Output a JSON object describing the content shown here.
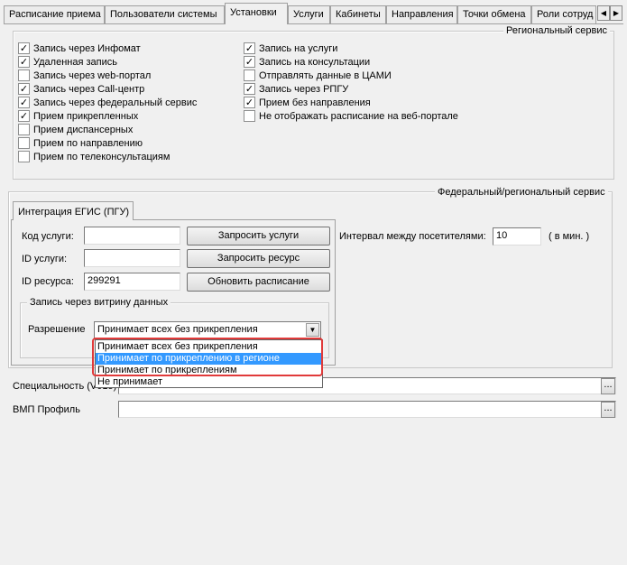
{
  "tabs": [
    {
      "label": "Расписание приема"
    },
    {
      "label": "Пользователи системы"
    },
    {
      "label": "Установки"
    },
    {
      "label": "Услуги"
    },
    {
      "label": "Кабинеты"
    },
    {
      "label": "Направления"
    },
    {
      "label": "Точки обмена"
    },
    {
      "label": "Роли сотруд"
    }
  ],
  "scroll": {
    "left": "◀",
    "right": "▶"
  },
  "regional": {
    "title": "Региональный сервис",
    "left": [
      {
        "label": "Запись через Инфомат",
        "checked": true
      },
      {
        "label": "Удаленная запись",
        "checked": true
      },
      {
        "label": "Запись через web-портал",
        "checked": false
      },
      {
        "label": "Запись через Call-центр",
        "checked": true
      },
      {
        "label": "Запись через федеральный сервис",
        "checked": true
      },
      {
        "label": "Прием прикрепленных",
        "checked": true
      },
      {
        "label": "Прием диспансерных",
        "checked": false
      },
      {
        "label": "Прием по направлению",
        "checked": false
      },
      {
        "label": "Прием по телеконсультациям",
        "checked": false
      }
    ],
    "right": [
      {
        "label": "Запись на услуги",
        "checked": true
      },
      {
        "label": "Запись на консультации",
        "checked": true
      },
      {
        "label": "Отправлять данные в ЦАМИ",
        "checked": false
      },
      {
        "label": "Запись через РПГУ",
        "checked": true
      },
      {
        "label": "Прием без направления",
        "checked": true
      },
      {
        "label": "Не отображать расписание на веб-портале",
        "checked": false
      }
    ]
  },
  "federal": {
    "title": "Федеральный/региональный сервис",
    "tab_label": "Интеграция ЕГИС (ПГУ)",
    "service_code_label": "Код услуги:",
    "service_code_value": "",
    "service_id_label": "ID услуги:",
    "service_id_value": "",
    "resource_id_label": "ID ресурса:",
    "resource_id_value": "299291",
    "btn_request_services": "Запросить услуги",
    "btn_request_resource": "Запросить ресурс",
    "btn_update_schedule": "Обновить расписание",
    "interval_label": "Интервал между посетителями:",
    "interval_value": "10",
    "interval_unit": "( в мин. )",
    "showcase_title": "Запись через витрину данных",
    "permission_label": "Разрешение",
    "permission_value": "Принимает всех без прикрепления",
    "options": [
      "Принимает всех без прикрепления",
      "Принимает по прикреплению в регионе",
      "Принимает по прикреплениям",
      "Не принимает"
    ]
  },
  "specialty_label": "Специальность (V015)",
  "specialty_value": "",
  "vmp_label": "ВМП Профиль",
  "vmp_value": "",
  "ellipsis": "..."
}
